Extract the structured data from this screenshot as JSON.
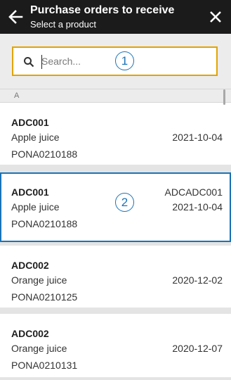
{
  "header": {
    "title": "Purchase orders to receive",
    "subtitle": "Select a product",
    "back_icon": "arrow-left-icon",
    "close_icon": "close-icon"
  },
  "search": {
    "placeholder": "Search...",
    "value": "",
    "icon": "search-icon",
    "badge": "1"
  },
  "section": {
    "letter": "A"
  },
  "items": [
    {
      "code": "ADC001",
      "product": "Apple juice",
      "date": "2021-10-04",
      "po": "PONA0210188",
      "variant": ""
    },
    {
      "code": "ADC001",
      "product": "Apple juice",
      "date": "2021-10-04",
      "po": "PONA0210188",
      "variant": "ADCADC001",
      "badge": "2"
    },
    {
      "code": "ADC002",
      "product": "Orange juice",
      "date": "2020-12-02",
      "po": "PONA0210125",
      "variant": ""
    },
    {
      "code": "ADC002",
      "product": "Orange juice",
      "date": "2020-12-07",
      "po": "PONA0210131",
      "variant": ""
    }
  ],
  "colors": {
    "header_bg": "#1b1b1b",
    "search_focus": "#e2a400",
    "selection": "#1a73b8"
  }
}
